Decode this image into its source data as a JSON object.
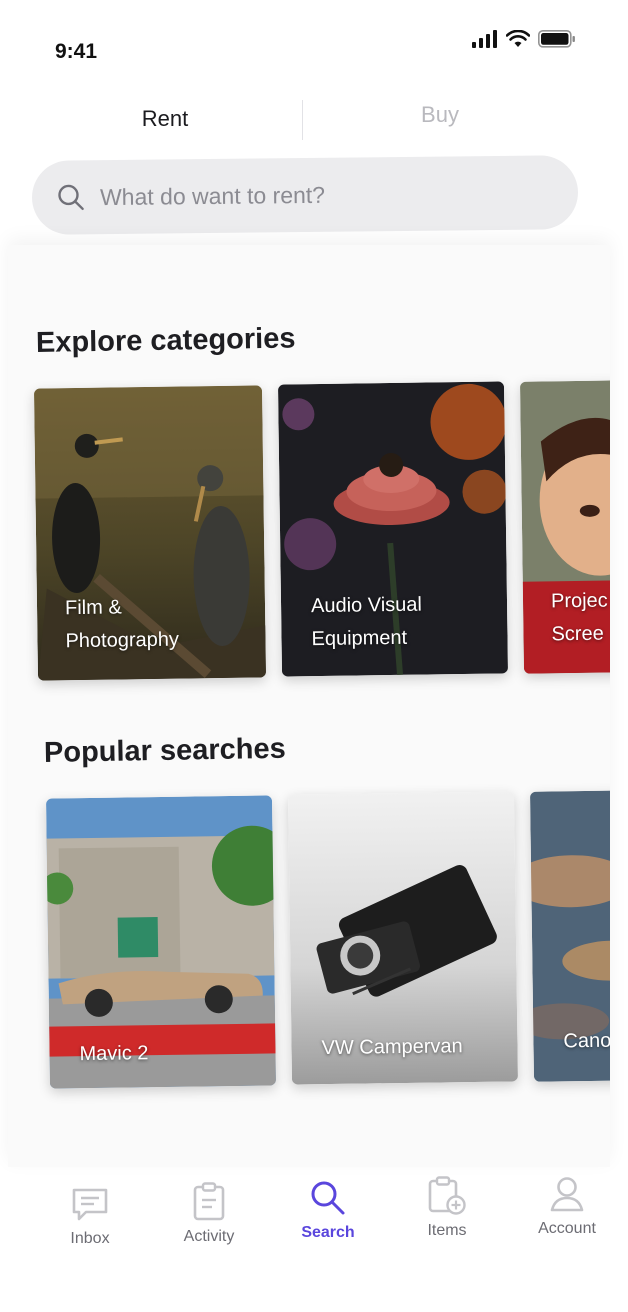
{
  "status_bar": {
    "time": "9:41"
  },
  "segmented": {
    "rent": "Rent",
    "buy": "Buy",
    "active": "Rent"
  },
  "search": {
    "placeholder": "What do want to rent?"
  },
  "explore": {
    "title": "Explore categories",
    "cards": [
      {
        "line1": "Film &",
        "line2": "Photography"
      },
      {
        "line1": "Audio Visual",
        "line2": "Equipment"
      },
      {
        "line1": "Projec",
        "line2": "Scree"
      }
    ]
  },
  "popular": {
    "title": "Popular searches",
    "cards": [
      {
        "label": "Mavic 2"
      },
      {
        "label": "VW Campervan"
      },
      {
        "label": "Canon"
      }
    ]
  },
  "nav": {
    "items": [
      {
        "label": "Inbox",
        "icon": "inbox-icon"
      },
      {
        "label": "Activity",
        "icon": "clipboard-icon"
      },
      {
        "label": "Search",
        "icon": "search-icon"
      },
      {
        "label": "Items",
        "icon": "items-add-icon"
      },
      {
        "label": "Account",
        "icon": "person-icon"
      }
    ],
    "active": "Search"
  },
  "colors": {
    "accent": "#5a46dd",
    "inactive": "#6c6c73",
    "search_bg": "#ececee"
  }
}
